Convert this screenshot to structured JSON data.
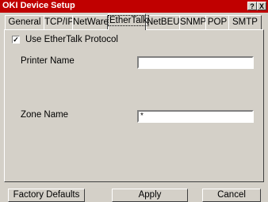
{
  "window": {
    "title": "OKI Device Setup",
    "help_icon": "?",
    "close_icon": "X"
  },
  "tabs": [
    {
      "label": "General"
    },
    {
      "label": "TCP/IP"
    },
    {
      "label": "NetWare"
    },
    {
      "label": "EtherTalk",
      "active": true
    },
    {
      "label": "NetBEUI"
    },
    {
      "label": "SNMP"
    },
    {
      "label": "POP"
    },
    {
      "label": "SMTP"
    }
  ],
  "ethertalk": {
    "use_protocol_label": "Use EtherTalk Protocol",
    "use_protocol_checked": true,
    "check_mark": "✓",
    "printer_name_label": "Printer Name",
    "printer_name_value": "",
    "zone_name_label": "Zone Name",
    "zone_name_value": "*"
  },
  "buttons": {
    "factory_defaults": "Factory Defaults",
    "apply": "Apply",
    "cancel": "Cancel"
  },
  "colors": {
    "titlebar": "#c00000",
    "face": "#d4d0c8"
  }
}
